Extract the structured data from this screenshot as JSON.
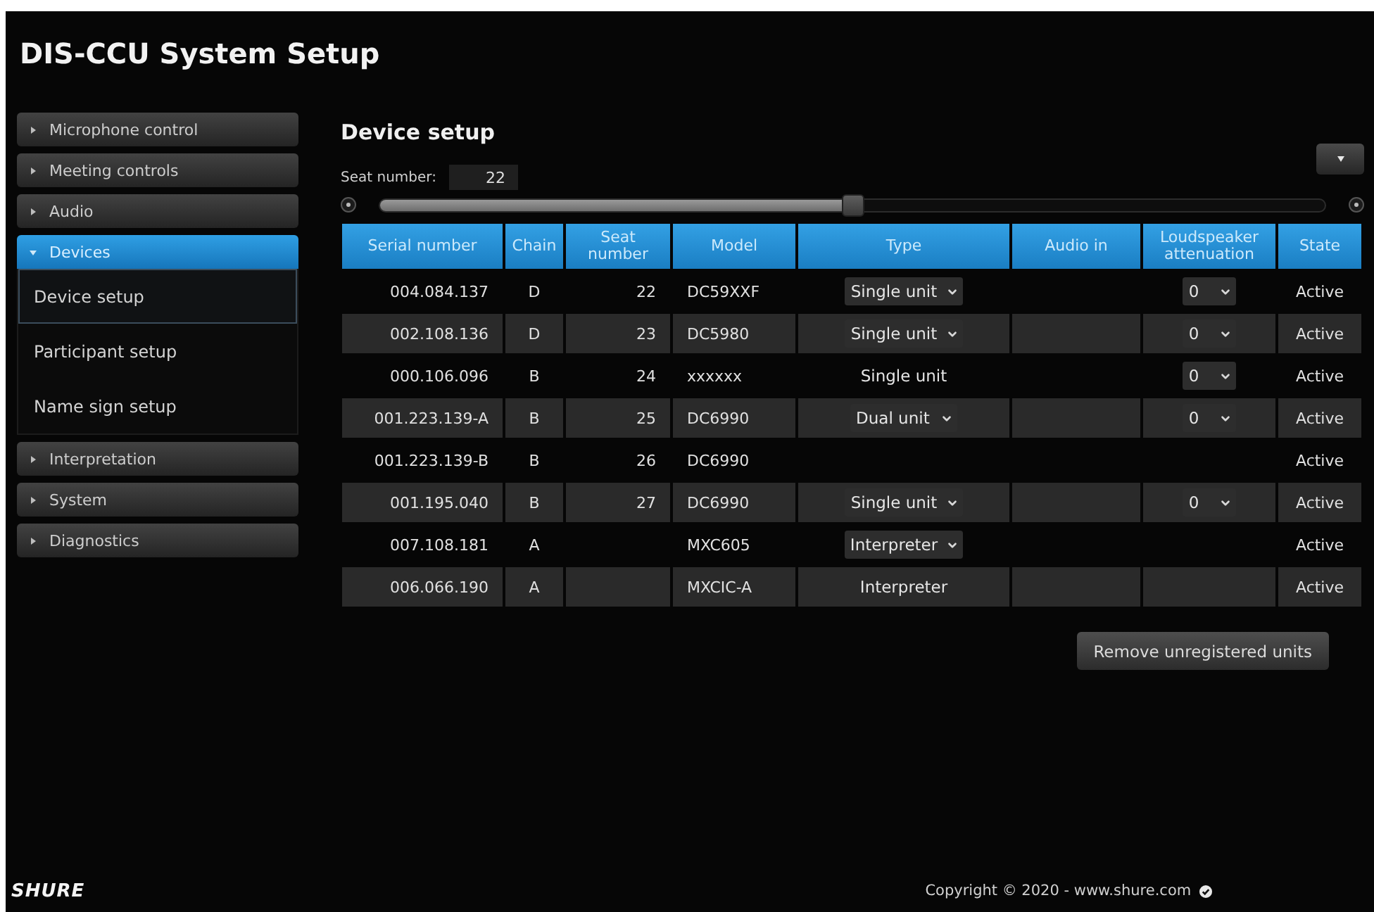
{
  "window": {
    "title": "DIS-CCU System Setup"
  },
  "sidebar": {
    "items": [
      {
        "label": "Microphone control",
        "selected": false,
        "expanded": false
      },
      {
        "label": "Meeting controls",
        "selected": false,
        "expanded": false
      },
      {
        "label": "Audio",
        "selected": false,
        "expanded": false
      },
      {
        "label": "Devices",
        "selected": true,
        "expanded": true,
        "children": [
          {
            "label": "Device setup",
            "selected": true
          },
          {
            "label": "Participant setup",
            "selected": false
          },
          {
            "label": "Name sign setup",
            "selected": false
          }
        ]
      },
      {
        "label": "Interpretation",
        "selected": false,
        "expanded": false
      },
      {
        "label": "System",
        "selected": false,
        "expanded": false
      },
      {
        "label": "Diagnostics",
        "selected": false,
        "expanded": false
      }
    ]
  },
  "content": {
    "heading": "Device setup",
    "seat_number": {
      "label": "Seat number:",
      "value": "22"
    },
    "slider": {
      "level": 0.5
    }
  },
  "table": {
    "columns": [
      "Serial number",
      "Chain",
      "Seat number",
      "Model",
      "Type",
      "Audio in",
      "Loudspeaker attenuation",
      "State"
    ],
    "rows": [
      {
        "serial_number": "004.084.137",
        "chain": "D",
        "seat_number": "22",
        "model": "DC59XXF",
        "type": {
          "kind": "select",
          "value": "Single unit"
        },
        "loudspeaker_attenuation": {
          "kind": "select",
          "value": "0"
        },
        "state": "Active"
      },
      {
        "serial_number": "002.108.136",
        "chain": "D",
        "seat_number": "23",
        "model": "DC5980",
        "type": {
          "kind": "select",
          "value": "Single unit"
        },
        "loudspeaker_attenuation": {
          "kind": "select",
          "value": "0"
        },
        "state": "Active"
      },
      {
        "serial_number": "000.106.096",
        "chain": "B",
        "seat_number": "24",
        "model": "xxxxxx",
        "type": {
          "kind": "text",
          "value": "Single unit"
        },
        "loudspeaker_attenuation": {
          "kind": "select",
          "value": "0"
        },
        "state": "Active"
      },
      {
        "serial_number": "001.223.139-A",
        "chain": "B",
        "seat_number": "25",
        "model": "DC6990",
        "type": {
          "kind": "select",
          "value": "Dual unit"
        },
        "loudspeaker_attenuation": {
          "kind": "select",
          "value": "0"
        },
        "state": "Active"
      },
      {
        "serial_number": "001.223.139-B",
        "chain": "B",
        "seat_number": "26",
        "model": "DC6990",
        "state": "Active"
      },
      {
        "serial_number": "001.195.040",
        "chain": "B",
        "seat_number": "27",
        "model": "DC6990",
        "type": {
          "kind": "select",
          "value": "Single unit"
        },
        "loudspeaker_attenuation": {
          "kind": "select",
          "value": "0"
        },
        "state": "Active"
      },
      {
        "serial_number": "007.108.181",
        "chain": "A",
        "model": "MXC605",
        "type": {
          "kind": "select",
          "value": "Interpreter"
        },
        "state": "Active"
      },
      {
        "serial_number": "006.066.190",
        "chain": "A",
        "model": "MXCIC-A",
        "type": {
          "kind": "text",
          "value": "Interpreter"
        },
        "state": "Active"
      }
    ]
  },
  "actions": {
    "remove_button": "Remove unregistered units"
  },
  "footer": {
    "logo": "SHURE",
    "copyright": "Copyright © 2020 - www.shure.com"
  }
}
